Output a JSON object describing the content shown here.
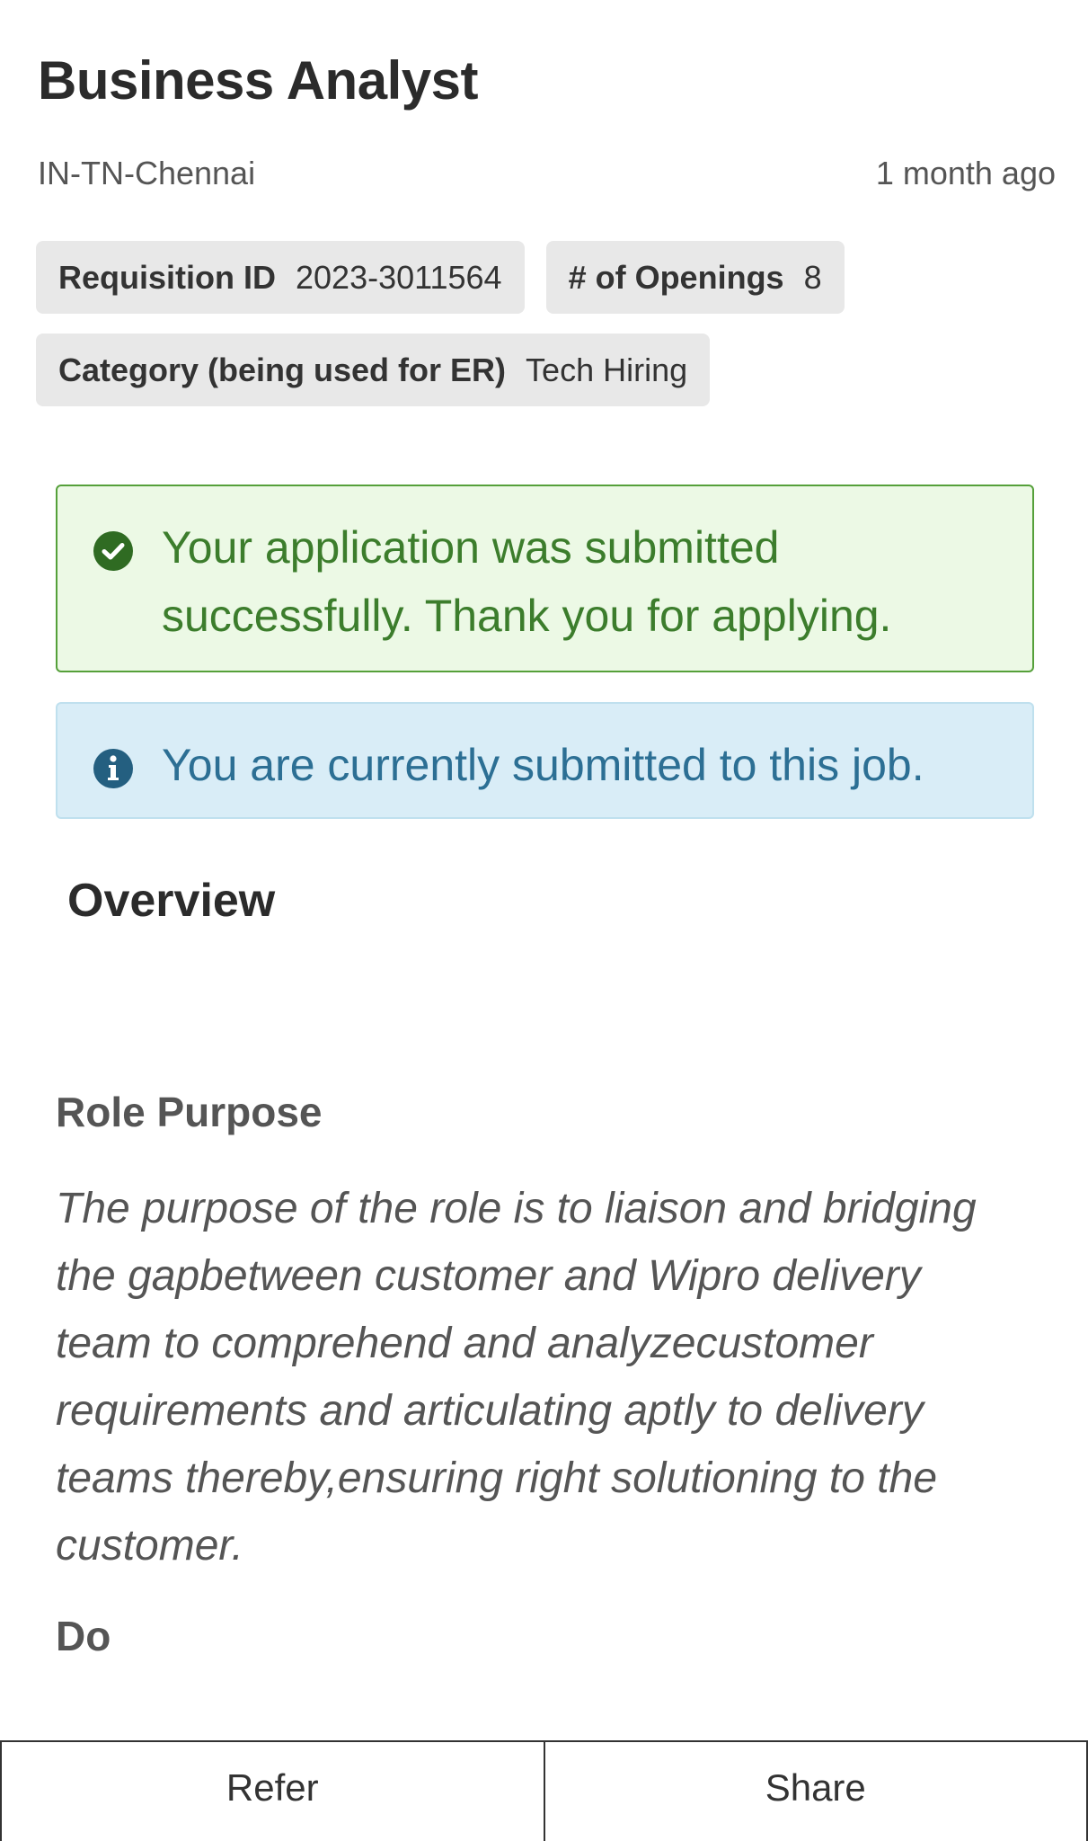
{
  "job": {
    "title": "Business Analyst",
    "location": "IN-TN-Chennai",
    "posted": "1 month ago"
  },
  "details": {
    "requisition_label": "Requisition ID",
    "requisition_value": "2023-3011564",
    "openings_label": "# of Openings",
    "openings_value": "8",
    "category_label": "Category (being used for ER)",
    "category_value": "Tech Hiring"
  },
  "alerts": {
    "success_text": "Your application was submitted successfully. Thank you for applying.",
    "success_icon": "check-circle-icon",
    "success_color": "#3c7d2c",
    "info_text": "You are currently submitted to this job.",
    "info_icon": "info-circle-icon",
    "info_color": "#2c6f94"
  },
  "content": {
    "overview_heading": "Overview",
    "role_purpose_heading": "Role Purpose",
    "role_purpose_text": "The purpose of the role is to liaison and bridging the gapbetween customer and Wipro delivery team to comprehend and analyzecustomer requirements and articulating aptly to delivery teams thereby,ensuring right solutioning to the customer.",
    "do_heading": "Do"
  },
  "actions": {
    "refer_label": "Refer",
    "share_label": "Share"
  }
}
